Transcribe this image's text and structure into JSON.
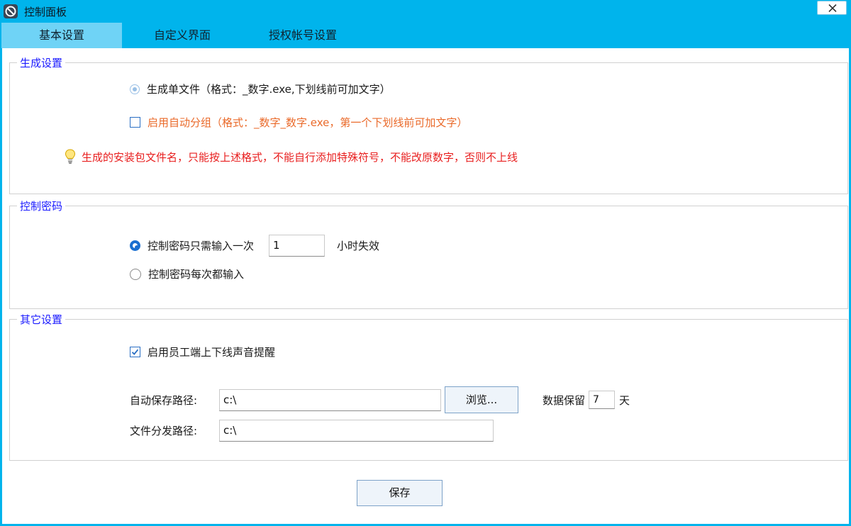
{
  "window": {
    "title": "控制面板"
  },
  "tabs": [
    {
      "label": "基本设置",
      "active": true
    },
    {
      "label": "自定义界面",
      "active": false
    },
    {
      "label": "授权帐号设置",
      "active": false
    }
  ],
  "generate_settings": {
    "legend": "生成设置",
    "single_file_label": "生成单文件（格式：_数字.exe,下划线前可加文字）",
    "single_file_selected": true,
    "auto_group_label": "启用自动分组（格式：_数字_数字.exe，第一个下划线前可加文字）",
    "auto_group_checked": false,
    "warning_text": "生成的安装包文件名，只能按上述格式，不能自行添加特殊符号，不能改原数字，否则不上线"
  },
  "control_password": {
    "legend": "控制密码",
    "option_once_label": "控制密码只需输入一次",
    "hours_value": "1",
    "hours_suffix": "小时失效",
    "option_every_label": "控制密码每次都输入",
    "selected": "once"
  },
  "other_settings": {
    "legend": "其它设置",
    "sound_alert_label": "启用员工端上下线声音提醒",
    "sound_alert_checked": true,
    "auto_save_path_label": "自动保存路径:",
    "auto_save_path_value": "c:\\",
    "browse_label": "浏览...",
    "retain_label": "数据保留",
    "retain_value": "7",
    "retain_unit": "天",
    "distribute_path_label": "文件分发路径:",
    "distribute_path_value": "c:\\"
  },
  "footer": {
    "save_label": "保存"
  },
  "colors": {
    "accent": "#00b4ec",
    "active_tab": "#6fd3f6",
    "legend": "#1a1aff",
    "orange_text": "#ea6a2a",
    "warning_text": "#e81e1e"
  }
}
